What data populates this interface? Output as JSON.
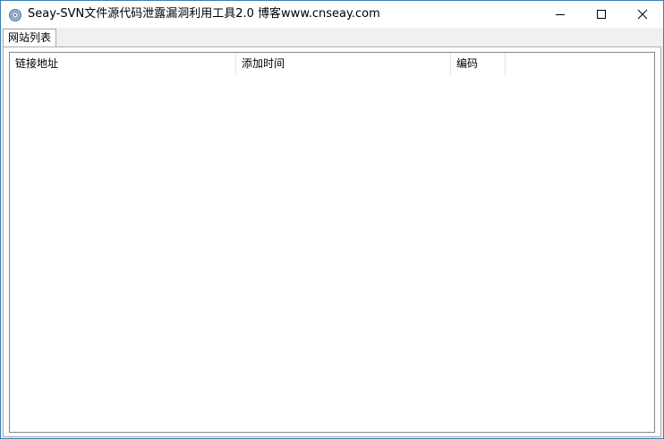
{
  "window": {
    "title": "Seay-SVN文件源代码泄露漏洞利用工具2.0  博客www.cnseay.com"
  },
  "tabs": [
    {
      "label": "网站列表"
    }
  ],
  "list": {
    "columns": [
      {
        "label": "链接地址"
      },
      {
        "label": "添加时间"
      },
      {
        "label": "编码"
      }
    ],
    "rows": []
  },
  "icons": {
    "app": "app-icon",
    "minimize": "minimize-icon",
    "maximize": "maximize-icon",
    "close": "close-icon"
  },
  "colors": {
    "window_border": "#3c7fb1",
    "titlebar_bg": "#ffffff",
    "client_bg": "#f0f0f0"
  }
}
